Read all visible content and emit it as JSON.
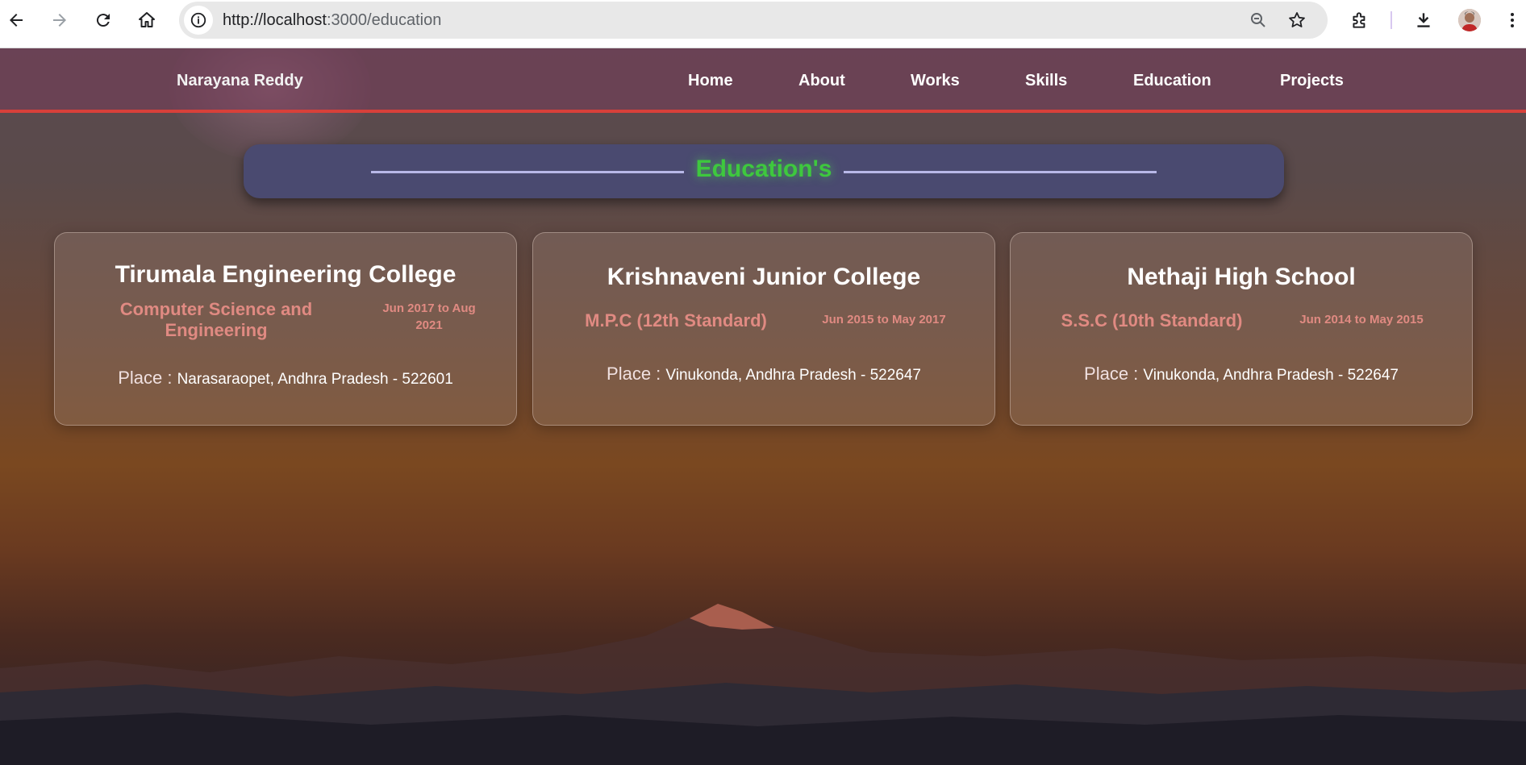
{
  "browser": {
    "url_host": "http://localhost",
    "url_rest": ":3000/education"
  },
  "header": {
    "brand": "Narayana Reddy",
    "nav": [
      "Home",
      "About",
      "Works",
      "Skills",
      "Education",
      "Projects"
    ]
  },
  "section": {
    "title": "Education's"
  },
  "cards": [
    {
      "institution": "Tirumala Engineering College",
      "degree": "Computer Science and Engineering",
      "dates": "Jun 2017 to Aug 2021",
      "place_label": "Place : ",
      "place": "Narasaraopet, Andhra Pradesh - 522601"
    },
    {
      "institution": "Krishnaveni Junior College",
      "degree": "M.P.C (12th Standard)",
      "dates": "Jun 2015 to May 2017",
      "place_label": "Place : ",
      "place": "Vinukonda, Andhra Pradesh - 522647"
    },
    {
      "institution": "Nethaji High School",
      "degree": "S.S.C (10th Standard)",
      "dates": "Jun 2014 to May 2015",
      "place_label": "Place : ",
      "place": "Vinukonda, Andhra Pradesh - 522647"
    }
  ],
  "colors": {
    "accent_green": "#3ec83e",
    "header_border": "#d8403a",
    "degree_text": "#e08a82",
    "title_bar": "#4a4a70"
  },
  "icons": [
    "back-arrow-icon",
    "forward-arrow-icon",
    "reload-icon",
    "home-icon",
    "site-info-icon",
    "zoom-icon",
    "star-icon",
    "extensions-icon",
    "download-icon",
    "menu-dots-icon"
  ]
}
